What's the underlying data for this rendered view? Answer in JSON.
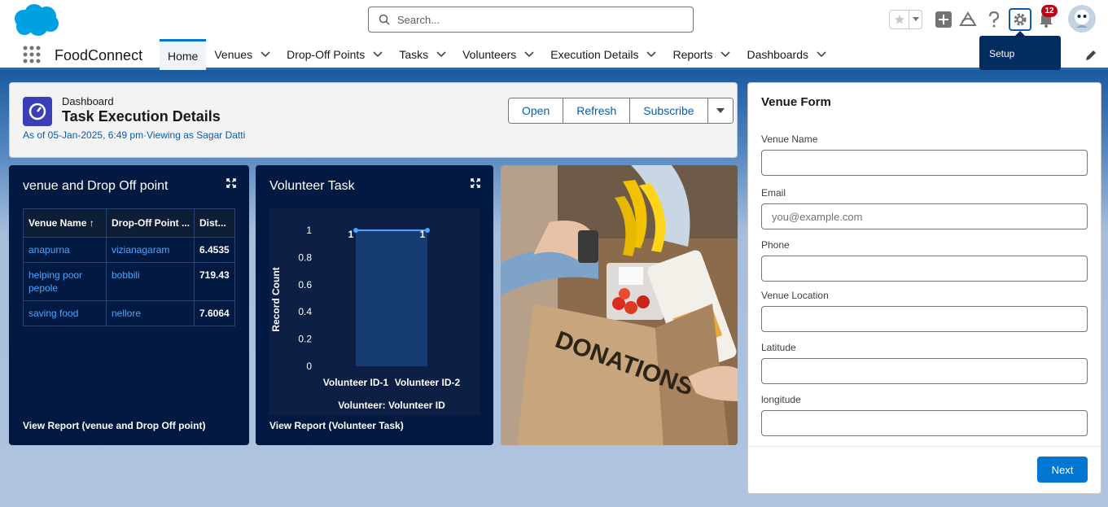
{
  "header": {
    "search_placeholder": "Search...",
    "notifications_count": "12",
    "setup_tooltip": "Setup"
  },
  "nav": {
    "app_name": "FoodConnect",
    "items": [
      {
        "label": "Home"
      },
      {
        "label": "Venues"
      },
      {
        "label": "Drop-Off Points"
      },
      {
        "label": "Tasks"
      },
      {
        "label": "Volunteers"
      },
      {
        "label": "Execution Details"
      },
      {
        "label": "Reports"
      },
      {
        "label": "Dashboards"
      }
    ]
  },
  "dashboard": {
    "type_label": "Dashboard",
    "title": "Task Execution Details",
    "meta": "As of 05-Jan-2025, 6:49 pm·Viewing as Sagar Datti",
    "buttons": {
      "open": "Open",
      "refresh": "Refresh",
      "subscribe": "Subscribe"
    }
  },
  "widget_table": {
    "title": "venue and Drop Off point",
    "columns": [
      "Venue Name ↑",
      "Drop-Off Point ...",
      "Dist..."
    ],
    "rows": [
      {
        "venue": "anapurna",
        "drop": "vizianagaram",
        "dist": "6.4535"
      },
      {
        "venue": "helping poor pepole",
        "drop": "bobbili",
        "dist": "719.43"
      },
      {
        "venue": "saving food",
        "drop": "nellore",
        "dist": "7.6064"
      }
    ],
    "footer": "View Report (venue and Drop Off point)"
  },
  "widget_chart": {
    "title": "Volunteer Task",
    "footer": "View Report (Volunteer Task)"
  },
  "chart_data": {
    "type": "line",
    "categories": [
      "Volunteer ID-1",
      "Volunteer ID-2"
    ],
    "values": [
      1,
      1
    ],
    "data_labels": [
      "1",
      "1"
    ],
    "xlabel": "Volunteer: Volunteer ID",
    "ylabel": "Record Count",
    "ylim": [
      0,
      1
    ],
    "yticks": [
      "0",
      "0.2",
      "0.4",
      "0.6",
      "0.8",
      "1"
    ],
    "colors": {
      "line": "#4aa6ff",
      "area": "#163a72"
    }
  },
  "venue_form": {
    "title": "Venue Form",
    "fields": [
      {
        "label": "Venue Name",
        "placeholder": ""
      },
      {
        "label": "Email",
        "placeholder": "you@example.com"
      },
      {
        "label": "Phone",
        "placeholder": ""
      },
      {
        "label": "Venue Location",
        "placeholder": ""
      },
      {
        "label": "Latitude",
        "placeholder": ""
      },
      {
        "label": "longitude",
        "placeholder": ""
      }
    ],
    "next_label": "Next"
  },
  "colors": {
    "brand": "#0176d3",
    "widget_bg": "#021a41",
    "link": "#0b5cab"
  }
}
